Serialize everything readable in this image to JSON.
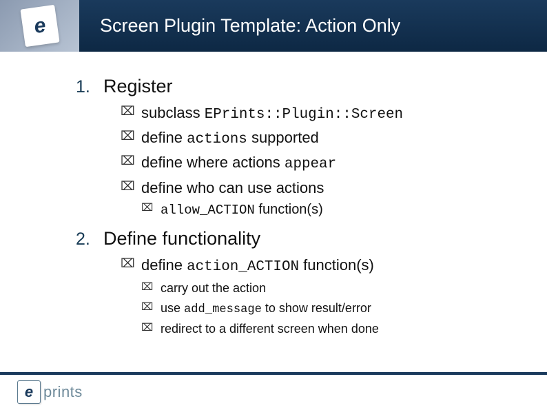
{
  "slide": {
    "title": "Screen Plugin Template: Action Only"
  },
  "list": {
    "n1": "1.",
    "item1": "Register",
    "sub1": [
      {
        "pre": "subclass ",
        "code": "EPrints::Plugin::Screen",
        "post": ""
      },
      {
        "pre": "define ",
        "code": "actions",
        "post": " supported"
      },
      {
        "pre": "define where actions ",
        "code": "appear",
        "post": ""
      },
      {
        "pre": "define who can use actions",
        "code": "",
        "post": ""
      }
    ],
    "sub1b": [
      {
        "code": "allow_ACTION",
        "post": " function(s)"
      }
    ],
    "n2": "2.",
    "item2": "Define functionality",
    "sub2": [
      {
        "pre": "define ",
        "code": "action_ACTION",
        "post": " function(s)"
      }
    ],
    "sub2b": [
      {
        "txt": "carry out the action"
      },
      {
        "pre": "use ",
        "code": "add_message",
        "post": " to show result/error"
      },
      {
        "txt": "redirect to a different screen when done"
      }
    ]
  },
  "footer": {
    "logo_e": "e",
    "logo_text": "prints"
  },
  "bullet": "⌧"
}
